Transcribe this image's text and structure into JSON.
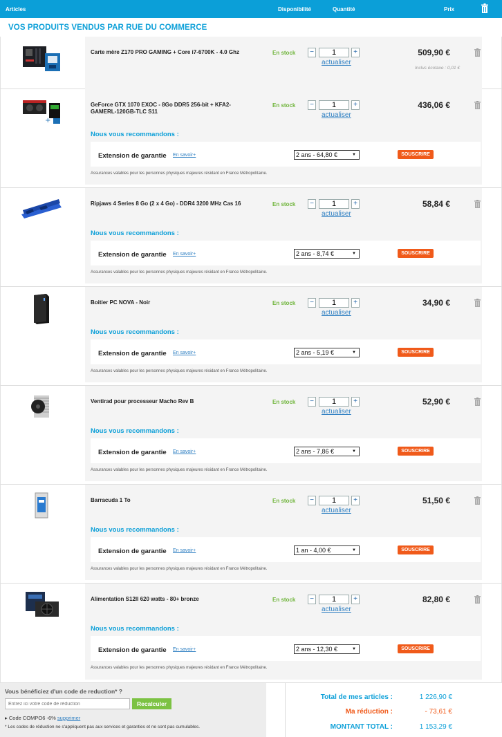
{
  "header": {
    "articles": "Articles",
    "disponibilite": "Disponibilité",
    "quantite": "Quantité",
    "prix": "Prix"
  },
  "section_title": "VOS PRODUITS VENDUS PAR RUE DU COMMERCE",
  "common": {
    "stock": "En stock",
    "actualiser": "actualiser",
    "recommend": "Nous vous recommandons :",
    "warranty_label": "Extension de garantie",
    "more": "En savoir+",
    "subscribe": "SOUSCRIRE",
    "insurance_note": "Assurances valables pour les personnes physiques majeures résidant en France Métropolitaine."
  },
  "products": [
    {
      "name": "Carte mère Z170 PRO GAMING + Core i7-6700K - 4.0 Ghz",
      "qty": "1",
      "price": "509,90 €",
      "ecotax": "Inclus écotaxe : 0,01 €",
      "image": "motherboard-cpu-image"
    },
    {
      "name": "GeForce GTX 1070 EXOC - 8Go DDR5 256-bit + KFA2-GAMERL-120GB-TLC S11",
      "qty": "1",
      "price": "436,06 €",
      "warranty": "2 ans - 64,80 €",
      "image": "graphics-card-image"
    },
    {
      "name": "Ripjaws 4 Series 8 Go (2 x 4 Go) - DDR4 3200 MHz Cas 16",
      "qty": "1",
      "price": "58,84 €",
      "warranty": "2 ans - 8,74 €",
      "image": "ram-image"
    },
    {
      "name": "Boitier PC NOVA - Noir",
      "qty": "1",
      "price": "34,90 €",
      "warranty": "2 ans - 5,19 €",
      "image": "pc-case-image"
    },
    {
      "name": "Ventirad pour processeur Macho Rev B",
      "qty": "1",
      "price": "52,90 €",
      "warranty": "2 ans - 7,86 €",
      "image": "cpu-cooler-image"
    },
    {
      "name": "Barracuda 1 To",
      "qty": "1",
      "price": "51,50 €",
      "warranty": "1 an - 4,00 €",
      "image": "hard-drive-image"
    },
    {
      "name": "Alimentation S12II 620 watts - 80+ bronze",
      "qty": "1",
      "price": "82,80 €",
      "warranty": "2 ans - 12,30 €",
      "image": "power-supply-image"
    }
  ],
  "promo": {
    "title": "Vous bénéficiez d'un code de reduction* ?",
    "placeholder": "Entrez ici votre code de réduction",
    "button": "Recalculer",
    "code": "Code COMPO6 -6%",
    "remove": "supprimer",
    "note": "* Les codes de réduction ne s'appliquent pas aux services et garanties et ne sont pas cumulables."
  },
  "totals": {
    "articles_label": "Total de mes articles :",
    "articles_value": "1 226,90 €",
    "reduction_label": "Ma réduction :",
    "reduction_value": "- 73,61 €",
    "total_label": "MONTANT TOTAL :",
    "total_value": "1 153,29 €"
  },
  "colors": {
    "accent": "#0b9fd8",
    "stock": "#6fb43a",
    "subscribe": "#f05a1a",
    "reduction": "#f05a1a",
    "recalc": "#7cc243"
  }
}
